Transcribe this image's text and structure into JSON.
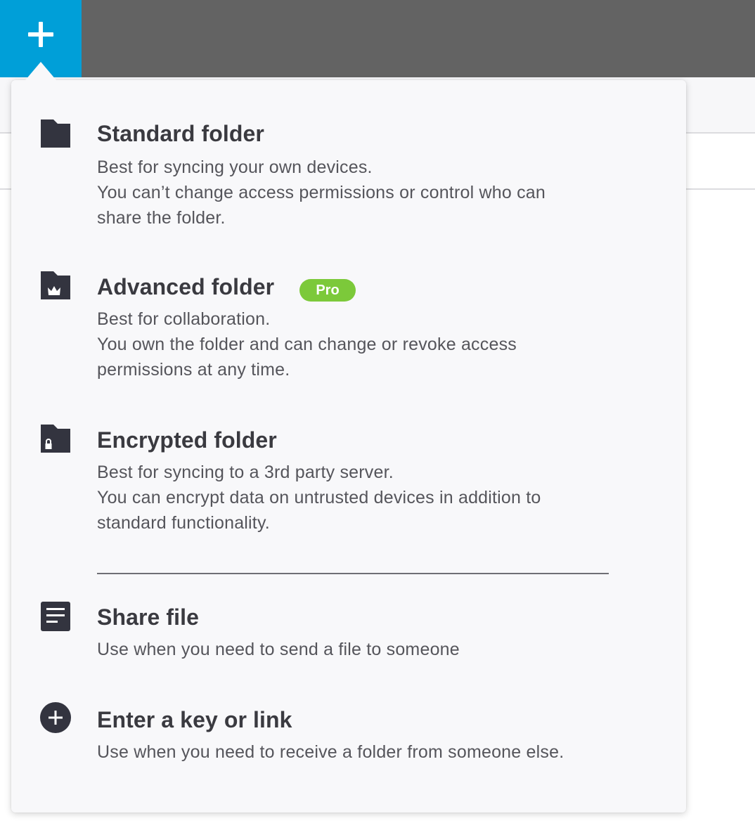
{
  "header": {
    "add_icon": "plus-icon",
    "accent_color": "#009fd8",
    "bar_color": "#636363"
  },
  "menu": {
    "items": [
      {
        "icon": "folder-icon",
        "title": "Standard folder",
        "desc": [
          "Best for syncing your own devices.",
          "You can’t change access permissions or control who can",
          "share the folder."
        ]
      },
      {
        "icon": "folder-crown-icon",
        "title": "Advanced folder",
        "badge": "Pro",
        "badge_color": "#7cc93a",
        "desc": [
          "Best for collaboration.",
          "You own the folder and can change or revoke access",
          "permissions at any time."
        ]
      },
      {
        "icon": "folder-lock-icon",
        "title": "Encrypted folder",
        "desc": [
          "Best for syncing to a 3rd party server.",
          "You can encrypt data on untrusted devices in addition to",
          "standard functionality."
        ]
      },
      {
        "icon": "document-icon",
        "title": "Share file",
        "desc": [
          "Use when you need to send a file to someone"
        ]
      },
      {
        "icon": "plus-circle-icon",
        "title": "Enter a key or link",
        "desc": [
          "Use when you need to receive a folder from someone else."
        ]
      }
    ]
  }
}
